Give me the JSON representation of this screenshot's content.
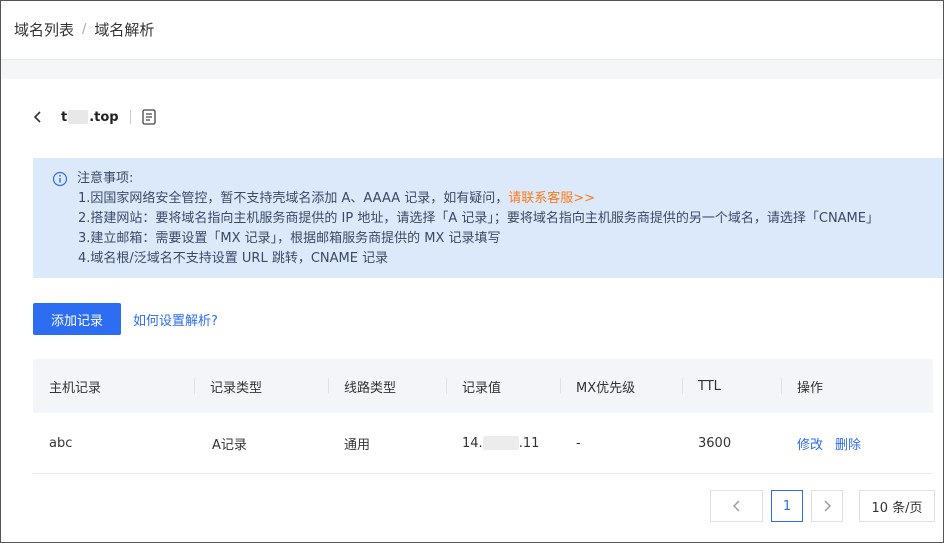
{
  "breadcrumb": {
    "items": [
      "域名列表",
      "域名解析"
    ],
    "separator": "/"
  },
  "domain": {
    "prefix": "t",
    "suffix": ".top"
  },
  "notice": {
    "title": "注意事项:",
    "items": [
      "1.因国家网络安全管控，暂不支持壳域名添加 A、AAAA 记录，如有疑问，",
      "2.搭建网站：要将域名指向主机服务商提供的 IP 地址，请选择「A 记录」；要将域名指向主机服务商提供的另一个域名，请选择「CNAME」",
      "3.建立邮箱：需要设置「MX 记录」，根据邮箱服务商提供的 MX 记录填写",
      "4.域名根/泛域名不支持设置 URL 跳转，CNAME 记录"
    ],
    "contact_link": "请联系客服>>"
  },
  "toolbar": {
    "add_label": "添加记录",
    "help_link": "如何设置解析?"
  },
  "table": {
    "headers": [
      "主机记录",
      "记录类型",
      "线路类型",
      "记录值",
      "MX优先级",
      "TTL",
      "操作"
    ],
    "rows": [
      {
        "host": "abc",
        "type": "A记录",
        "line": "通用",
        "value_prefix": "14.",
        "value_suffix": ".11",
        "mx": "-",
        "ttl": "3600",
        "actions": [
          "修改",
          "删除"
        ]
      }
    ]
  },
  "pagination": {
    "current_page": "1",
    "page_size": "10 条/页"
  },
  "colors": {
    "primary": "#2c6df1",
    "notice_bg": "#dce9fb",
    "link_orange": "#ff7a1a"
  }
}
